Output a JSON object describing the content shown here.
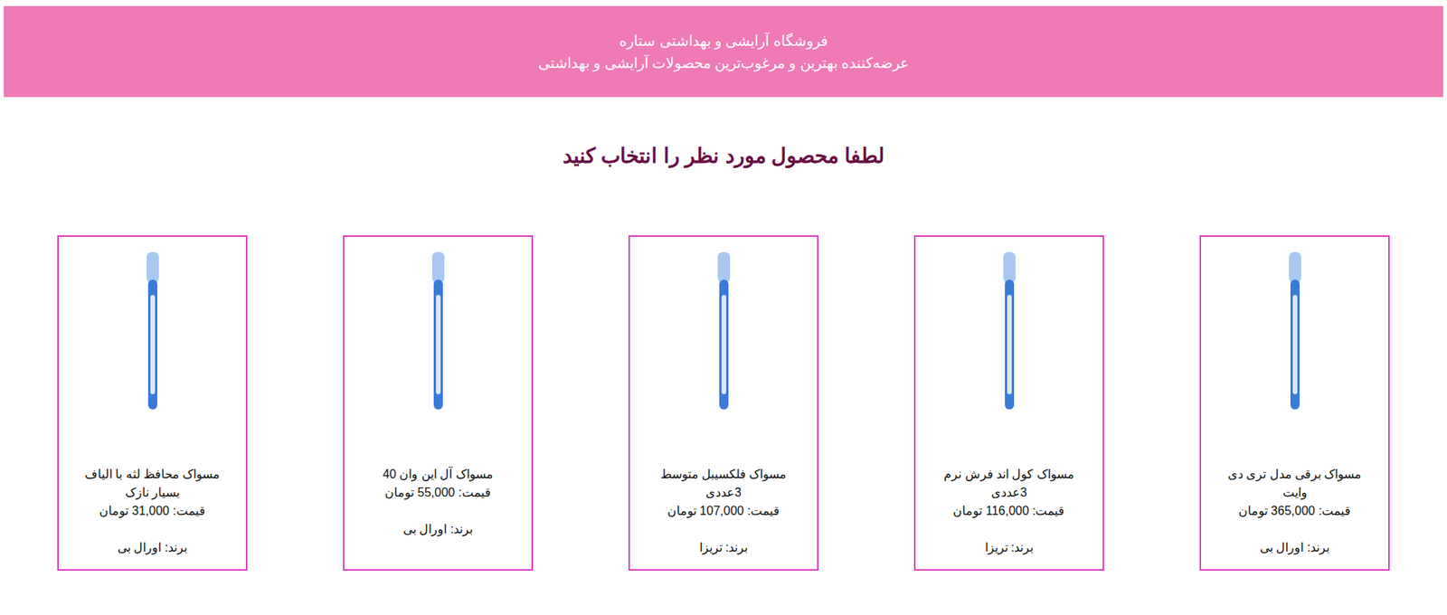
{
  "header": {
    "title": "فروشگاه آرایشی و بهداشتی ستاره",
    "subtitle": "عرضه‌کننده بهترین و مرغوب‌ترین محصولات آرایشی و بهداشتی"
  },
  "heading": "لطفا محصول مورد نظر را انتخاب کنید",
  "products": [
    {
      "name": "مسواک برقی مدل تری دی وایت",
      "price_label": "قیمت:",
      "price": "365,000",
      "currency": "تومان",
      "brand_label": "برند:",
      "brand": "اورال بی"
    },
    {
      "name": "مسواک کول اند فرش نرم 3عددی",
      "price_label": "قیمت:",
      "price": "116,000",
      "currency": "تومان",
      "brand_label": "برند:",
      "brand": "تریزا"
    },
    {
      "name": "مسواک فلکسیبل متوسط 3عددی",
      "price_label": "قیمت:",
      "price": "107,000",
      "currency": "تومان",
      "brand_label": "برند:",
      "brand": "تریزا"
    },
    {
      "name": "مسواک آل این وان 40",
      "price_label": "قیمت:",
      "price": "55,000",
      "currency": "تومان",
      "brand_label": "برند:",
      "brand": "اورال بی"
    },
    {
      "name": "مسواک محافظ لثه با الیاف بسیار نازک",
      "price_label": "قیمت:",
      "price": "31,000",
      "currency": "تومان",
      "brand_label": "برند:",
      "brand": "اورال بی"
    }
  ]
}
